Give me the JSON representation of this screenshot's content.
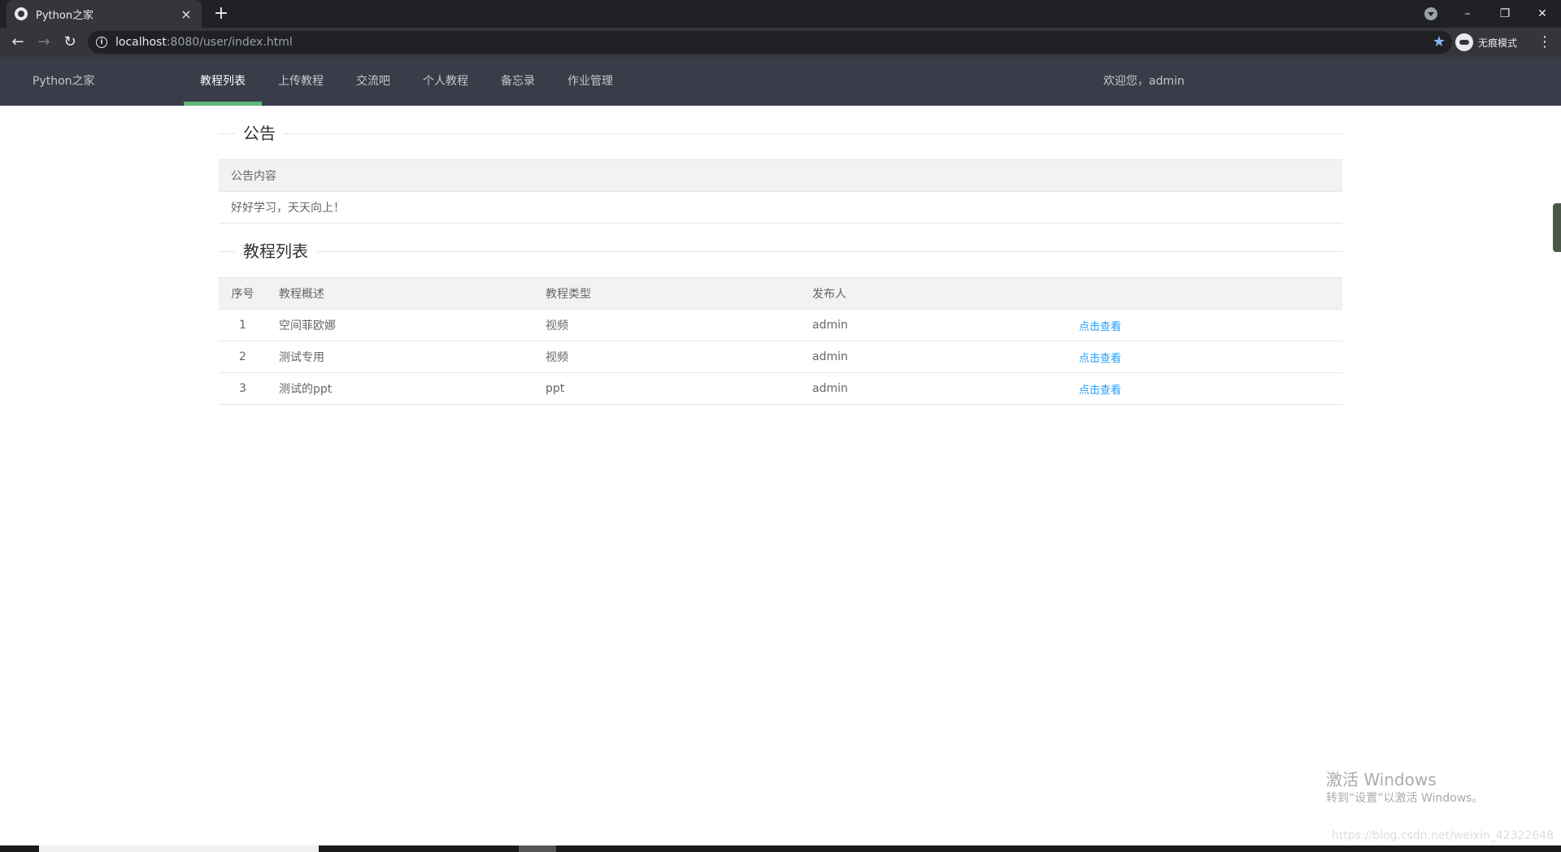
{
  "browser": {
    "tab_title": "Python之家",
    "tab_close": "×",
    "new_tab": "+",
    "url_host": "localhost",
    "url_rest": ":8080/user/index.html",
    "incognito_label": "无痕模式",
    "window_controls": {
      "minimize": "–",
      "maximize": "❐",
      "close": "✕"
    }
  },
  "header": {
    "logo": "Python之家",
    "nav": [
      {
        "label": "教程列表",
        "active": true
      },
      {
        "label": "上传教程",
        "active": false
      },
      {
        "label": "交流吧",
        "active": false
      },
      {
        "label": "个人教程",
        "active": false
      },
      {
        "label": "备忘录",
        "active": false
      },
      {
        "label": "作业管理",
        "active": false
      }
    ],
    "welcome": "欢迎您，admin"
  },
  "notice": {
    "section_title": "公告",
    "column_header": "公告内容",
    "content": "好好学习，天天向上！"
  },
  "tutorials": {
    "section_title": "教程列表",
    "columns": [
      "序号",
      "教程概述",
      "教程类型",
      "发布人",
      ""
    ],
    "rows": [
      {
        "no": "1",
        "summary": "空间菲欧娜",
        "type": "视频",
        "publisher": "admin",
        "action": "点击查看"
      },
      {
        "no": "2",
        "summary": "测试专用",
        "type": "视频",
        "publisher": "admin",
        "action": "点击查看"
      },
      {
        "no": "3",
        "summary": "测试的ppt",
        "type": "ppt",
        "publisher": "admin",
        "action": "点击查看"
      }
    ]
  },
  "watermark": {
    "line1": "激活 Windows",
    "line2": "转到“设置”以激活 Windows。",
    "line3": "https://blog.csdn.net/weixin_42322648"
  },
  "colors": {
    "header_bg": "#393d49",
    "active_underline": "#5fb878",
    "link": "#1e9fff"
  }
}
